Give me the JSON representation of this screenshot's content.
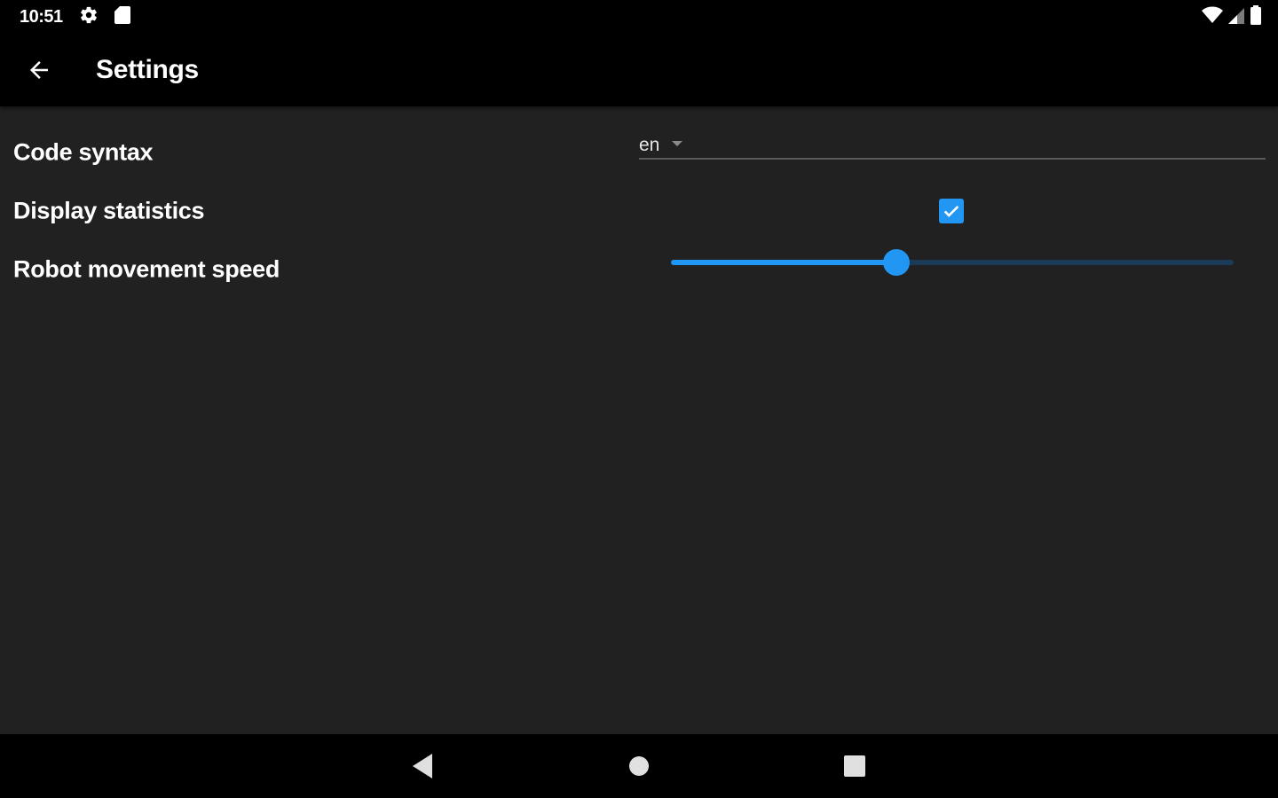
{
  "status_bar": {
    "time": "10:51",
    "icons": [
      "gear-icon",
      "sd-card-icon",
      "wifi-icon",
      "signal-icon",
      "battery-icon"
    ]
  },
  "app_bar": {
    "title": "Settings",
    "back_icon": "arrow-back-icon"
  },
  "settings": {
    "code_syntax": {
      "label": "Code syntax",
      "value": "en"
    },
    "display_statistics": {
      "label": "Display statistics",
      "checked": true
    },
    "robot_speed": {
      "label": "Robot movement speed",
      "value_fraction": 0.4
    }
  },
  "nav_bar": {
    "icons": [
      "nav-back-icon",
      "nav-home-icon",
      "nav-recents-icon"
    ]
  },
  "colors": {
    "accent": "#2196f3",
    "background": "#212121",
    "bars": "#000000"
  }
}
